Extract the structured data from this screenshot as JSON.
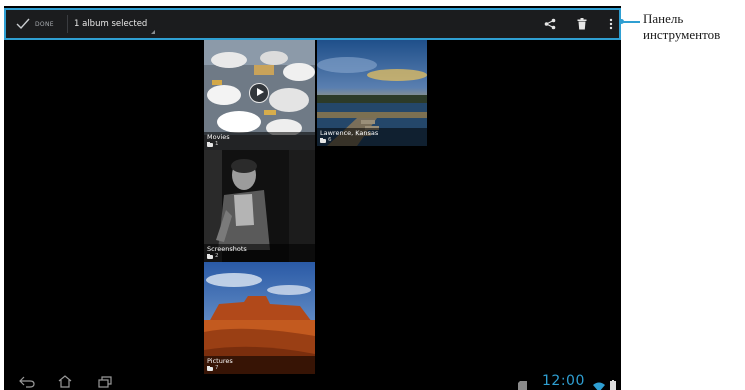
{
  "action_bar": {
    "done_label": "DONE",
    "selection_label": "1 album selected",
    "accent_color": "#2f9fd2",
    "icons": [
      "check-icon",
      "share-icon",
      "trash-icon",
      "overflow-menu-icon"
    ]
  },
  "albums": [
    {
      "name": "Movies",
      "count": "1",
      "selected": false,
      "has_video": true
    },
    {
      "name": "Lawrence, Kansas",
      "count": "6",
      "selected": true,
      "has_video": false
    },
    {
      "name": "Screenshots",
      "count": "2",
      "selected": false,
      "has_video": false
    },
    {
      "name": "Pictures",
      "count": "7",
      "selected": false,
      "has_video": false
    }
  ],
  "system_bar": {
    "clock": "12:00",
    "icons": [
      "back-icon",
      "home-icon",
      "recents-icon",
      "sd-card-icon",
      "wifi-icon",
      "battery-icon"
    ]
  },
  "callout": {
    "line1": "Панель",
    "line2": "инструментов"
  }
}
